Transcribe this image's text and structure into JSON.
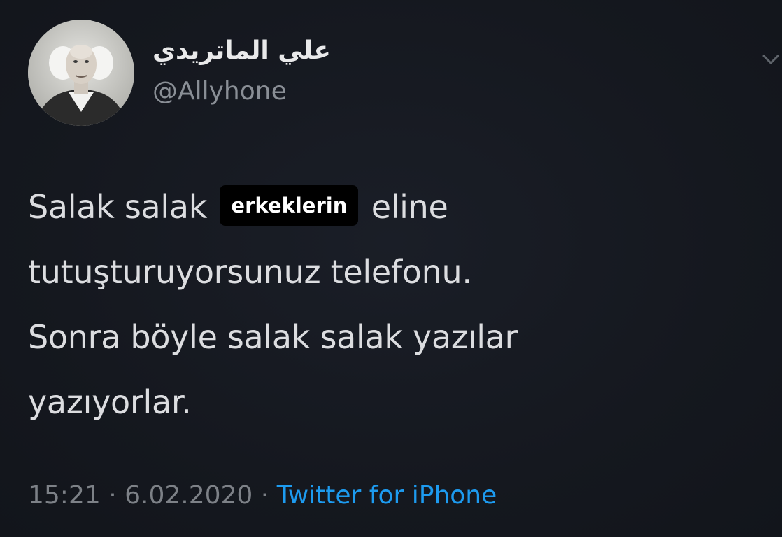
{
  "author": {
    "display_name": "علي الماتريدي",
    "handle": "@Allyhone"
  },
  "tweet": {
    "line1_before": "Salak salak",
    "highlight": "erkeklerin",
    "line1_after": "eline",
    "line2": "tutuşturuyorsunuz telefonu.",
    "line3": "Sonra böyle salak salak yazılar",
    "line4": "yazıyorlar."
  },
  "meta": {
    "time": "15:21",
    "separator": "·",
    "date": "6.02.2020",
    "source": "Twitter for iPhone"
  },
  "icons": {
    "menu": "chevron-down-icon",
    "avatar": "avatar"
  },
  "colors": {
    "background": "#15181f",
    "text": "#dcdde0",
    "muted": "#7d8187",
    "link": "#1d9bf0",
    "highlight_bg": "#000000"
  }
}
